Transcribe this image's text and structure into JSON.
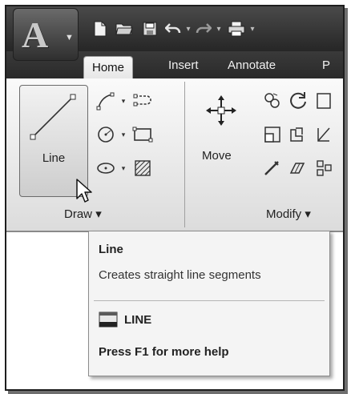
{
  "quick_access": {
    "items": [
      "new-icon",
      "open-icon",
      "save-icon",
      "undo-icon",
      "redo-icon",
      "plot-icon"
    ]
  },
  "tabs": [
    {
      "label": "Home",
      "active": true
    },
    {
      "label": "Insert",
      "active": false
    },
    {
      "label": "Annotate",
      "active": false
    },
    {
      "label": "P",
      "active": false
    }
  ],
  "draw_panel": {
    "line_label": "Line",
    "title": "Draw",
    "title_caret": "▾"
  },
  "modify_panel": {
    "move_label": "Move",
    "title": "Modify",
    "title_caret": "▾"
  },
  "tooltip": {
    "title": "Line",
    "description": "Creates straight line segments",
    "command": "LINE",
    "help": "Press F1 for more help"
  },
  "colors": {
    "title_bar": "#2f2f2f",
    "ribbon": "#e6e6e6",
    "tooltip_bg": "#f4f4f4"
  }
}
